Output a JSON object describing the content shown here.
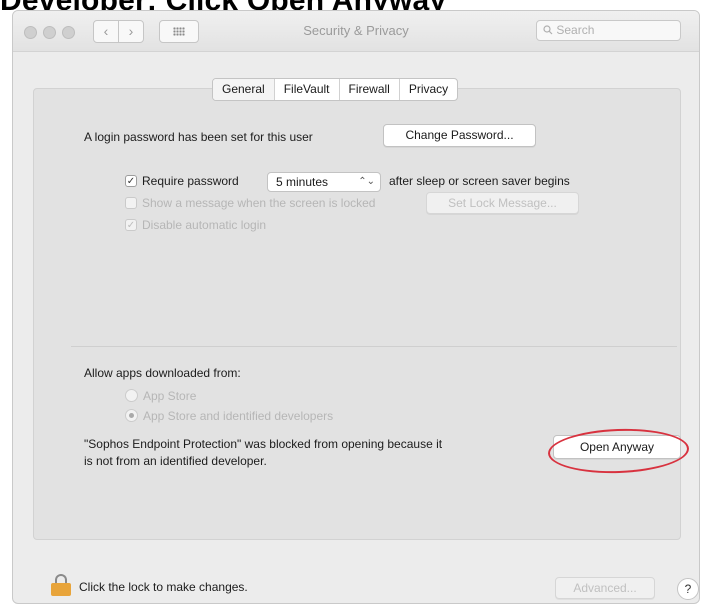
{
  "caption": "Developer: Click Open Anyway",
  "window": {
    "title": "Security & Privacy",
    "search_placeholder": "Search",
    "back_symbol": "‹",
    "forward_symbol": "›"
  },
  "tabs": [
    {
      "label": "General",
      "selected": true
    },
    {
      "label": "FileVault",
      "selected": false
    },
    {
      "label": "Firewall",
      "selected": false
    },
    {
      "label": "Privacy",
      "selected": false
    }
  ],
  "general": {
    "login_password_text": "A login password has been set for this user",
    "change_password_label": "Change Password...",
    "require_password_label": "Require password",
    "require_password_checked": true,
    "require_password_delay": "5 minutes",
    "after_sleep_text": "after sleep or screen saver begins",
    "show_message_label": "Show a message when the screen is locked",
    "show_message_checked": false,
    "set_lock_message_label": "Set Lock Message...",
    "disable_auto_login_label": "Disable automatic login",
    "disable_auto_login_checked": true
  },
  "apps": {
    "heading": "Allow apps downloaded from:",
    "option_app_store": "App Store",
    "option_identified": "App Store and identified developers",
    "selected": "App Store and identified developers",
    "blocked_message_line1": "\"Sophos Endpoint Protection\" was blocked from opening because it",
    "blocked_message_line2": "is not from an identified developer.",
    "open_anyway_label": "Open Anyway"
  },
  "footer": {
    "lock_text": "Click the lock to make changes.",
    "advanced_label": "Advanced...",
    "help_label": "?"
  },
  "check_mark": "✓",
  "select_arrows": "⌃⌄",
  "colors": {
    "highlight_ring": "#d8323f",
    "lock_body": "#e8a43a"
  }
}
